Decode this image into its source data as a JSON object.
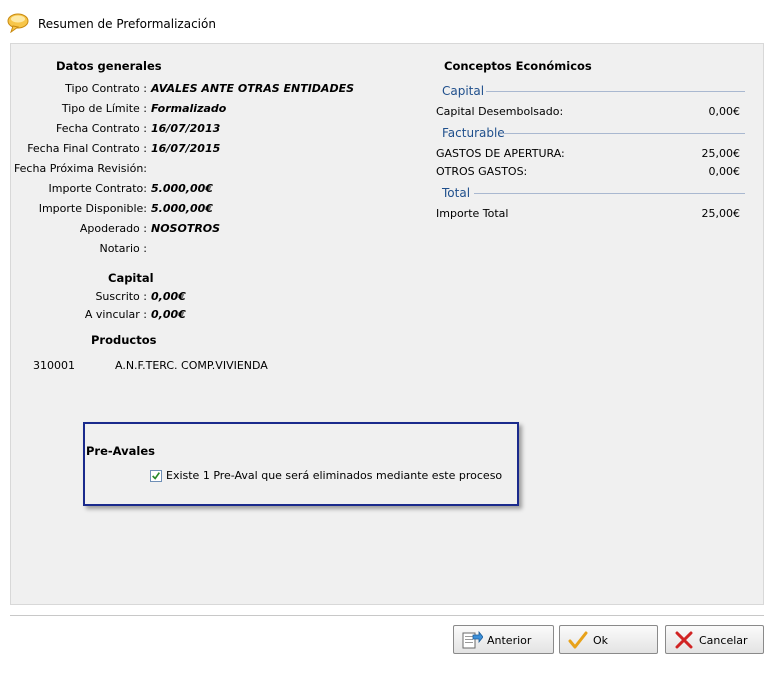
{
  "window": {
    "title": "Resumen de Preformalización",
    "icon": "speech-bubble-icon"
  },
  "datos_generales": {
    "heading": "Datos generales",
    "rows": [
      {
        "label": "Tipo Contrato :",
        "value": "AVALES ANTE OTRAS ENTIDADES"
      },
      {
        "label": "Tipo de Límite :",
        "value": "Formalizado"
      },
      {
        "label": "Fecha Contrato :",
        "value": "16/07/2013"
      },
      {
        "label": "Fecha Final Contrato :",
        "value": "16/07/2015"
      },
      {
        "label": "Fecha Próxima Revisión:",
        "value": ""
      },
      {
        "label": "Importe Contrato:",
        "value": "5.000,00€"
      },
      {
        "label": "Importe Disponible:",
        "value": "5.000,00€"
      },
      {
        "label": "Apoderado :",
        "value": "NOSOTROS"
      },
      {
        "label": "Notario :",
        "value": ""
      }
    ]
  },
  "capital": {
    "heading": "Capital",
    "rows": [
      {
        "label": "Suscrito :",
        "value": "0,00€"
      },
      {
        "label": "A vincular :",
        "value": "0,00€"
      }
    ]
  },
  "productos": {
    "heading": "Productos",
    "items": [
      {
        "code": "310001",
        "name": "A.N.F.TERC. COMP.VIVIENDA"
      }
    ]
  },
  "conceptos": {
    "heading": "Conceptos Económicos",
    "groups": [
      {
        "title": "Capital",
        "rows": [
          {
            "label": "Capital Desembolsado:",
            "value": "0,00€"
          }
        ]
      },
      {
        "title": "Facturable",
        "rows": [
          {
            "label": "GASTOS DE APERTURA:",
            "value": "25,00€"
          },
          {
            "label": "OTROS GASTOS:",
            "value": "0,00€"
          }
        ]
      },
      {
        "title": "Total",
        "rows": [
          {
            "label": "Importe Total",
            "value": "25,00€"
          }
        ]
      }
    ]
  },
  "pre_avales": {
    "heading": "Pre-Avales",
    "checkbox_label": "Existe 1 Pre-Aval que será eliminados mediante este proceso",
    "checked": true
  },
  "buttons": {
    "anterior": "Anterior",
    "ok": "Ok",
    "cancelar": "Cancelar"
  }
}
